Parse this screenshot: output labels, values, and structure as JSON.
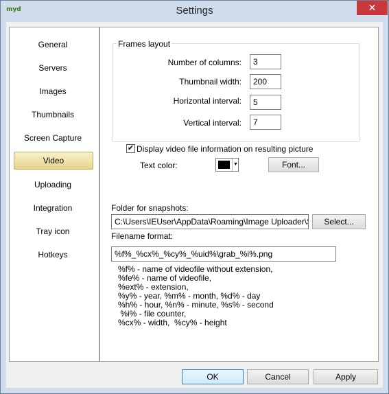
{
  "window": {
    "title": "Settings",
    "app_icon_text": "myd",
    "close_label": "✕"
  },
  "sidebar": {
    "items": [
      {
        "label": "General"
      },
      {
        "label": "Servers"
      },
      {
        "label": "Images"
      },
      {
        "label": "Thumbnails"
      },
      {
        "label": "Screen Capture"
      },
      {
        "label": "Video",
        "selected": true
      },
      {
        "label": "Uploading"
      },
      {
        "label": "Integration"
      },
      {
        "label": "Tray icon"
      },
      {
        "label": "Hotkeys"
      }
    ]
  },
  "frames": {
    "legend": "Frames layout",
    "columns_label": "Number of columns:",
    "columns_value": "3",
    "thumb_width_label": "Thumbnail width:",
    "thumb_width_value": "200",
    "h_interval_label": "Horizontal interval:",
    "h_interval_value": "5",
    "v_interval_label": "Vertical interval:",
    "v_interval_value": "7"
  },
  "video_info": {
    "checkbox_label": "Display video file information on resulting picture",
    "checked": true,
    "text_color_label": "Text color:",
    "text_color": "#000000",
    "font_button": "Font..."
  },
  "snapshots": {
    "folder_label": "Folder for snapshots:",
    "folder_value": "C:\\Users\\IEUser\\AppData\\Roaming\\Image Uploader\\Snapshots",
    "select_button": "Select...",
    "filename_label": "Filename format:",
    "filename_value": "%f%_%cx%_%cy%_%uid%\\grab_%i%.png",
    "help": [
      "%f% - name of videofile without extension,",
      "%fe% - name of videofile,",
      "%ext% - extension,",
      "%y% - year, %m% - month, %d% - day",
      "%h% - hour, %n% - minute, %s% - second",
      " %i% - file counter,",
      "%cx% - width,  %cy% - height"
    ]
  },
  "footer": {
    "ok": "OK",
    "cancel": "Cancel",
    "apply": "Apply"
  }
}
